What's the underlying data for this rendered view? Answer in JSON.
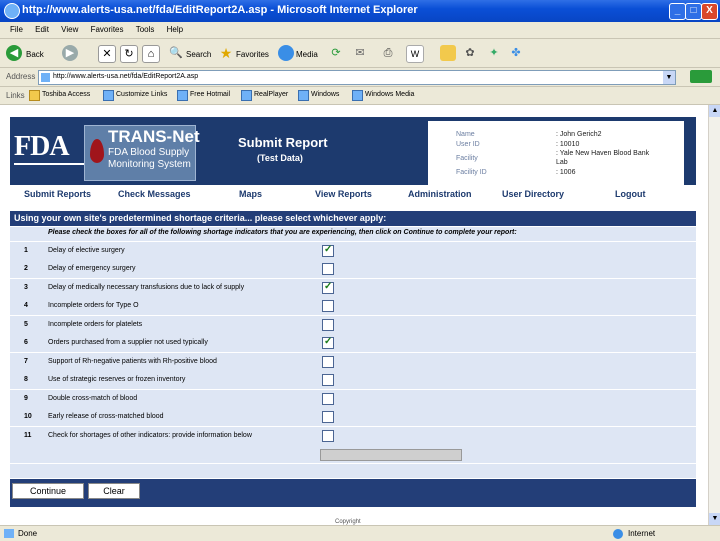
{
  "window": {
    "title": "http://www.alerts-usa.net/fda/EditReport2A.asp - Microsoft Internet Explorer",
    "min": "_",
    "max": "□",
    "close": "X"
  },
  "menu": [
    "File",
    "Edit",
    "View",
    "Favorites",
    "Tools",
    "Help"
  ],
  "toolbar": {
    "back": "Back",
    "search": "Search",
    "favorites": "Favorites",
    "media": "Media"
  },
  "address": {
    "label": "Address",
    "url": "http://www.alerts-usa.net/fda/EditReport2A.asp"
  },
  "links": {
    "label": "Links",
    "items": [
      "Toshiba Access",
      "Customize Links",
      "Free Hotmail",
      "RealPlayer",
      "Windows",
      "Windows Media"
    ]
  },
  "header": {
    "logo": "FDA",
    "transnet_title": "TRANS-Net",
    "transnet_sub1": "FDA Blood Supply",
    "transnet_sub2": "Monitoring System",
    "page_title": "Submit Report",
    "page_subtitle": "(Test Data)",
    "info": [
      {
        "label": "Name",
        "value": ": John Gerich2"
      },
      {
        "label": "User ID",
        "value": ": 10010"
      },
      {
        "label": "Facility",
        "value": ": Yale New Haven Blood Bank"
      },
      {
        "label": "",
        "value": "Lab"
      },
      {
        "label": "Facility ID",
        "value": ": 1006"
      }
    ]
  },
  "nav": [
    "Submit Reports",
    "Check Messages",
    "Maps",
    "View Reports",
    "Administration",
    "User Directory",
    "Logout"
  ],
  "form": {
    "instruction": "Using your own site's predetermined shortage criteria... please select whichever apply:",
    "subinstruction": "Please check the boxes for all of the following shortage indicators that you are experiencing, then click on Continue to complete your report:",
    "rows": [
      {
        "num": "1",
        "text": "Delay of elective surgery",
        "checked": true
      },
      {
        "num": "2",
        "text": "Delay of emergency surgery",
        "checked": false
      },
      {
        "num": "3",
        "text": "Delay of medically necessary transfusions due to lack of supply",
        "checked": true
      },
      {
        "num": "4",
        "text": "Incomplete orders for Type O",
        "checked": false
      },
      {
        "num": "5",
        "text": "Incomplete orders for platelets",
        "checked": false
      },
      {
        "num": "6",
        "text": "Orders purchased from a supplier not used typically",
        "checked": true
      },
      {
        "num": "7",
        "text": "Support of Rh-negative patients with Rh-positive blood",
        "checked": false
      },
      {
        "num": "8",
        "text": "Use of strategic reserves or frozen inventory",
        "checked": false
      },
      {
        "num": "9",
        "text": "Double cross-match of blood",
        "checked": false
      },
      {
        "num": "10",
        "text": "Early release of cross-matched blood",
        "checked": false
      },
      {
        "num": "11",
        "text": "Check for shortages of other indicators: provide information below",
        "checked": false
      }
    ],
    "continue_label": "Continue",
    "clear_label": "Clear"
  },
  "footer": {
    "copyright": "Copyright"
  },
  "status": {
    "text": "Done",
    "zone": "Internet"
  }
}
